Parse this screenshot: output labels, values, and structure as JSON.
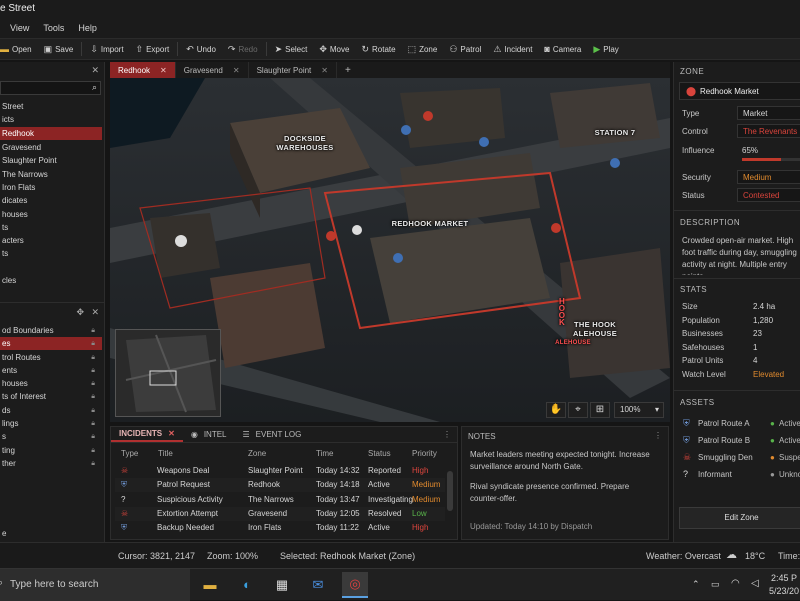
{
  "window": {
    "title": "e Street"
  },
  "menu": [
    "View",
    "Tools",
    "Help"
  ],
  "toolbar": {
    "open": "Open",
    "save": "Save",
    "import": "Import",
    "export": "Export",
    "undo": "Undo",
    "redo": "Redo",
    "select": "Select",
    "move": "Move",
    "rotate": "Rotate",
    "zone": "Zone",
    "patrol": "Patrol",
    "incident": "Incident",
    "camera": "Camera",
    "play": "Play"
  },
  "left_tree": {
    "items": [
      "Street",
      "icts",
      "Redhook",
      "Gravesend",
      "Slaughter Point",
      "The Narrows",
      "Iron Flats",
      "dicates",
      "houses",
      "ts",
      "acters",
      "ts",
      "cles"
    ],
    "selected": "Redhook"
  },
  "left_layers": {
    "items": [
      "od Boundaries",
      "es",
      "trol Routes",
      "ents",
      "houses",
      "ts of Interest",
      "ds",
      "lings",
      "s",
      "ting",
      "ther"
    ],
    "selected": "es",
    "footer": "e"
  },
  "tabs": [
    {
      "label": "Redhook",
      "active": true
    },
    {
      "label": "Gravesend"
    },
    {
      "label": "Slaughter Point"
    }
  ],
  "map": {
    "labels": {
      "dockside": "DOCKSIDE WAREHOUSES",
      "redhook_market": "REDHOOK MARKET",
      "station": "STATION 7",
      "hook": "THE HOOK ALEHOUSE",
      "sign_hook": "HOOK",
      "sign_alehouse": "ALEHOUSE"
    },
    "zoom": "100%"
  },
  "incidents": {
    "tabs": [
      "INCIDENTS",
      "INTEL",
      "EVENT LOG"
    ],
    "headers": [
      "Type",
      "Title",
      "Zone",
      "Time",
      "Status",
      "Priority"
    ],
    "rows": [
      {
        "icon": "skull-icon",
        "title": "Weapons Deal",
        "zone": "Slaughter Point",
        "time": "Today 14:32",
        "status": "Reported",
        "priority": "High",
        "pcolor": "#e0463e"
      },
      {
        "icon": "badge-icon",
        "title": "Patrol Request",
        "zone": "Redhook",
        "time": "Today 14:18",
        "status": "Active",
        "priority": "Medium",
        "pcolor": "#e08a2e"
      },
      {
        "icon": "question-icon",
        "title": "Suspicious Activity",
        "zone": "The Narrows",
        "time": "Today 13:47",
        "status": "Investigating",
        "priority": "Medium",
        "pcolor": "#e08a2e"
      },
      {
        "icon": "skull-icon",
        "title": "Extortion Attempt",
        "zone": "Gravesend",
        "time": "Today 12:05",
        "status": "Resolved",
        "priority": "Low",
        "pcolor": "#58b34a"
      },
      {
        "icon": "badge-icon",
        "title": "Backup Needed",
        "zone": "Iron Flats",
        "time": "Today 11:22",
        "status": "Active",
        "priority": "High",
        "pcolor": "#e0463e"
      }
    ]
  },
  "notes": {
    "title": "NOTES",
    "p1": "Market leaders meeting expected tonight. Increase surveillance around North Gate.",
    "p2": "Rival syndicate presence confirmed. Prepare counter-offer.",
    "updated": "Updated: Today 14:10 by Dispatch"
  },
  "zone": {
    "section": "ZONE",
    "name": "Redhook Market",
    "type_label": "Type",
    "type": "Market",
    "control_label": "Control",
    "control": "The Revenants",
    "influence_label": "Influence",
    "influence": "65%",
    "influence_value": 0.65,
    "security_label": "Security",
    "security": "Medium",
    "status_label": "Status",
    "status": "Contested",
    "colors": {
      "control": "#d9443c",
      "security": "#e08a2e",
      "status": "#d9443c"
    }
  },
  "description": {
    "section": "DESCRIPTION",
    "text": "Crowded open-air market. High foot traffic during day, smuggling activity at night. Multiple entry points."
  },
  "stats": {
    "section": "STATS",
    "rows": [
      {
        "k": "Size",
        "v": "2.4 ha"
      },
      {
        "k": "Population",
        "v": "1,280"
      },
      {
        "k": "Businesses",
        "v": "23"
      },
      {
        "k": "Safehouses",
        "v": "1"
      },
      {
        "k": "Patrol Units",
        "v": "4"
      },
      {
        "k": "Watch Level",
        "v": "Elevated",
        "color": "#e08a2e"
      }
    ]
  },
  "assets": {
    "section": "ASSETS",
    "rows": [
      {
        "icon": "badge-icon",
        "name": "Patrol Route A",
        "status": "Active",
        "color": "#58b34a"
      },
      {
        "icon": "badge-icon",
        "name": "Patrol Route B",
        "status": "Active",
        "color": "#58b34a"
      },
      {
        "icon": "skull-icon",
        "name": "Smuggling Den",
        "status": "Suspe",
        "color": "#e08a2e"
      },
      {
        "icon": "question-icon",
        "name": "Informant",
        "status": "Unkno",
        "color": "#999999"
      }
    ]
  },
  "edit_zone": "Edit Zone",
  "statusbar": {
    "cursor": "Cursor: 3821, 2147",
    "zoom": "Zoom: 100%",
    "selected": "Selected: Redhook Market (Zone)",
    "weather": "Weather: Overcast",
    "temp": "18°C",
    "time": "Time:"
  },
  "taskbar": {
    "search": "Type here to search",
    "clock": "2:45 P",
    "date": "5/23/20"
  }
}
